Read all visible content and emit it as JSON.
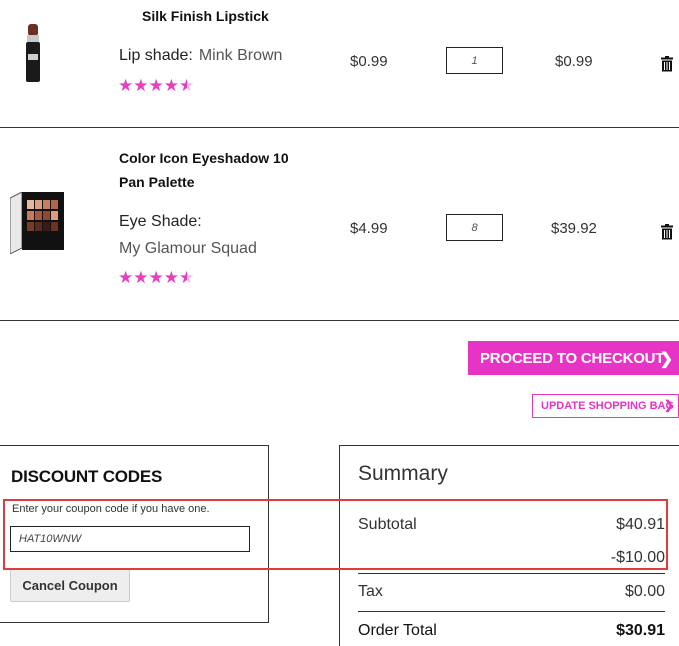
{
  "items": [
    {
      "name": "Silk Finish Lipstick",
      "attr_label": "Lip shade:",
      "attr_value": "Mink Brown",
      "rating_stars": 4.5,
      "price": "$0.99",
      "qty": "1",
      "subtotal": "$0.99"
    },
    {
      "name_line1": "Color Icon Eyeshadow 10",
      "name_line2": "Pan Palette",
      "attr_label": "Eye Shade:",
      "attr_value": "My Glamour Squad",
      "rating_stars": 4.5,
      "price": "$4.99",
      "qty": "8",
      "subtotal": "$39.92"
    }
  ],
  "actions": {
    "checkout": "PROCEED TO CHECKOUT",
    "update_bag": "UPDATE SHOPPING BAG"
  },
  "discount": {
    "title": "DISCOUNT CODES",
    "hint": "Enter your coupon code if you have one.",
    "coupon_value": "HAT10WNW",
    "cancel_label": "Cancel Coupon"
  },
  "summary": {
    "title": "Summary",
    "subtotal_label": "Subtotal",
    "subtotal_value": "$40.91",
    "discount_value": "-$10.00",
    "tax_label": "Tax",
    "tax_value": "$0.00",
    "total_label": "Order Total",
    "total_value": "$30.91"
  },
  "colors": {
    "accent": "#e834c4",
    "highlight": "#e33b3b"
  }
}
